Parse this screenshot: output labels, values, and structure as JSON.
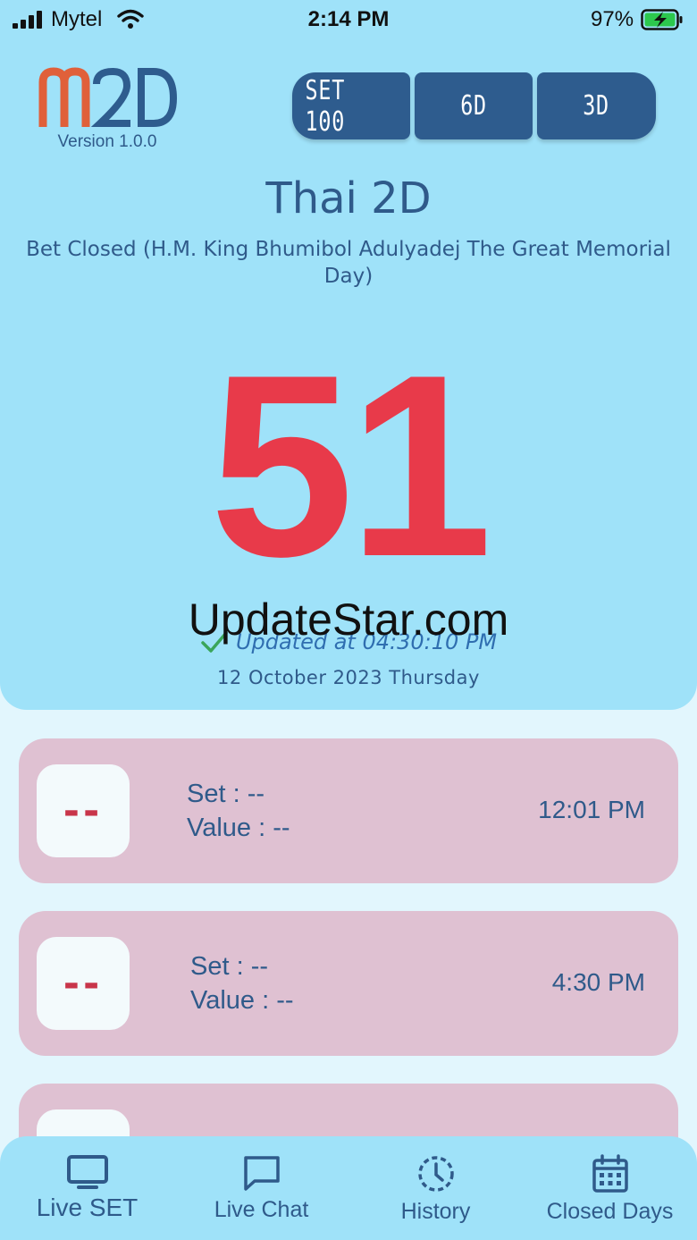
{
  "status_bar": {
    "carrier": "Mytel",
    "time": "2:14 PM",
    "battery": "97%"
  },
  "header": {
    "logo_text": "m2D",
    "version": "Version 1.0.0",
    "segments": [
      {
        "label": "SET 100"
      },
      {
        "label": "6D"
      },
      {
        "label": "3D"
      }
    ]
  },
  "main": {
    "title": "Thai 2D",
    "status_message": "Bet Closed (H.M. King Bhumibol Adulyadej The Great Memorial Day)",
    "result": "51",
    "updated": "Updated at 04:30:10 PM",
    "date": "12 October 2023 Thursday",
    "watermark": "UpdateStar.com"
  },
  "results": [
    {
      "number": "--",
      "set": "Set : --",
      "value": "Value : --",
      "time": "12:01 PM"
    },
    {
      "number": "--",
      "set": "Set : --",
      "value": "Value : --",
      "time": "4:30 PM"
    }
  ],
  "tabs": [
    {
      "label": "Live SET",
      "icon": "tv-icon"
    },
    {
      "label": "Live Chat",
      "icon": "chat-icon"
    },
    {
      "label": "History",
      "icon": "history-icon"
    },
    {
      "label": "Closed Days",
      "icon": "calendar-icon"
    }
  ],
  "colors": {
    "panel": "#9fe2f9",
    "accent": "#2e5c8e",
    "result": "#e83a4a",
    "card": "#dfc1d2",
    "logo_m": "#e0603a"
  }
}
